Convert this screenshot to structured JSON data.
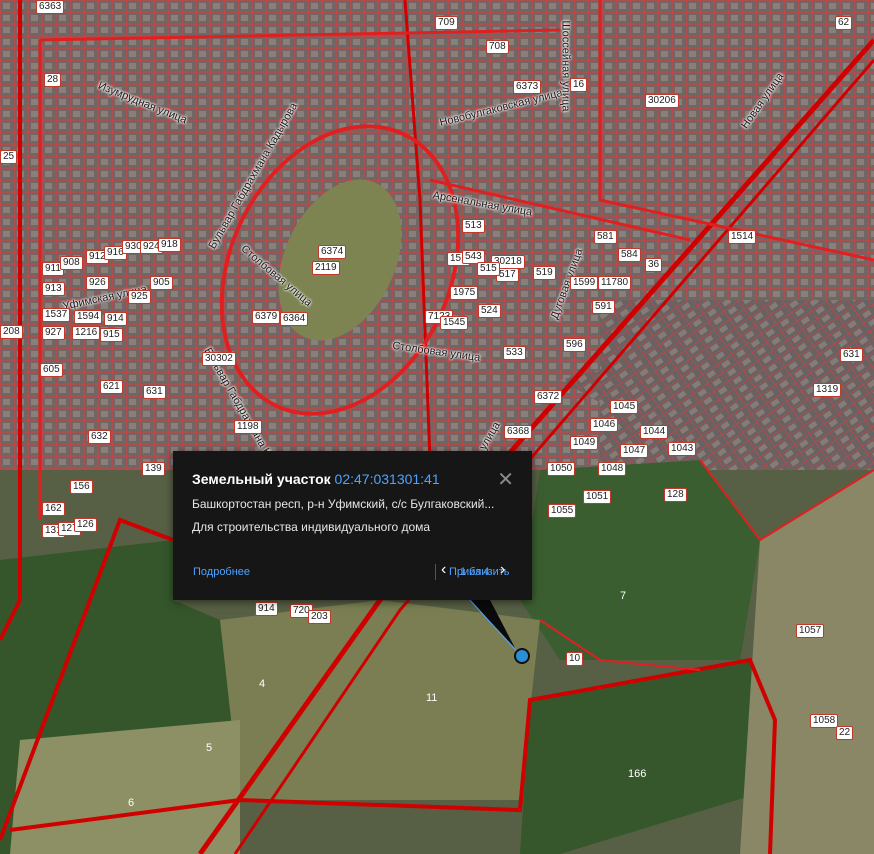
{
  "popup": {
    "title": "Земельный участок",
    "cad_number": "02:47:031301:41",
    "address": "Башкортостан респ, р-н Уфимский, с/с Булгаковский...",
    "usage": "Для строительства индивидуального дома",
    "more_link": "Подробнее",
    "zoom_link": "Приблизить",
    "pager": "1 из 4",
    "close_icon": "close-icon",
    "prev_icon": "chevron-left-icon",
    "next_icon": "chevron-right-icon"
  },
  "streets": [
    "Изумрудная улица",
    "Бульвар Габдрахмана Кадырова",
    "Новобулгаковская улица",
    "Шоссейная улица",
    "Новая улица",
    "Арсенальная улица",
    "Столбовая улица",
    "Столбовая улица",
    "Уфимская улица",
    "Дуговая улица",
    "Бульвар Габдрахмана Кадырова",
    "улица"
  ],
  "parcel_labels": [
    "6363",
    "709",
    "708",
    "6373",
    "16",
    "30206",
    "62",
    "28",
    "25",
    "6374",
    "2119",
    "513",
    "151",
    "543",
    "30218",
    "517",
    "519",
    "515",
    "1975",
    "524",
    "581",
    "584",
    "36",
    "1599",
    "11780",
    "1514",
    "6379",
    "6364",
    "7123",
    "1545",
    "533",
    "596",
    "591",
    "631",
    "30302",
    "605",
    "621",
    "631",
    "632",
    "1198",
    "6372",
    "6368",
    "1045",
    "1046",
    "1044",
    "1049",
    "1047",
    "1043",
    "1319",
    "1050",
    "1048",
    "1051",
    "128",
    "1055",
    "139",
    "156",
    "162",
    "131",
    "127",
    "126",
    "913",
    "911",
    "908",
    "912",
    "916",
    "930",
    "924",
    "918",
    "926",
    "905",
    "925",
    "1537",
    "1594",
    "914",
    "927",
    "1216",
    "915",
    "208",
    "914",
    "720",
    "203",
    "7",
    "10",
    "1057",
    "1058",
    "22",
    "4",
    "5",
    "6",
    "11",
    "166"
  ],
  "colors": {
    "parcel_border": "#e02020",
    "road_border": "#d00000",
    "popup_bg": "#161616",
    "link": "#4da3ff",
    "forest": "#34562a",
    "field": "#7a7e52"
  },
  "marker_icon": "location-pin-icon"
}
